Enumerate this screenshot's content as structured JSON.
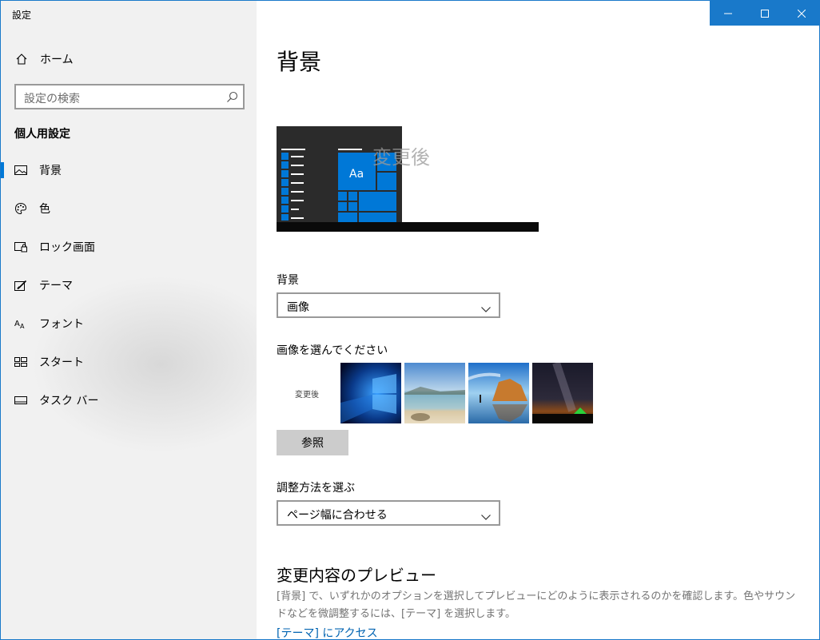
{
  "window": {
    "title": "設定",
    "controls": [
      "minimize-icon",
      "maximize-icon",
      "close-icon"
    ],
    "accent": "#0078d7"
  },
  "sidebar": {
    "home_label": "ホーム",
    "search_placeholder": "設定の検索",
    "section_title": "個人用設定",
    "items": [
      {
        "label": "背景",
        "icon": "picture-icon",
        "active": true
      },
      {
        "label": "色",
        "icon": "palette-icon",
        "active": false
      },
      {
        "label": "ロック画面",
        "icon": "lock-screen-icon",
        "active": false
      },
      {
        "label": "テーマ",
        "icon": "theme-brush-icon",
        "active": false
      },
      {
        "label": "フォント",
        "icon": "font-icon",
        "active": false
      },
      {
        "label": "スタート",
        "icon": "start-icon",
        "active": false
      },
      {
        "label": "タスク バー",
        "icon": "taskbar-icon",
        "active": false
      }
    ]
  },
  "main": {
    "title": "背景",
    "preview": {
      "tile_text": "Aa",
      "overlay_text": "変更後"
    },
    "background_label": "背景",
    "background_value": "画像",
    "choose_picture_label": "画像を選んでください",
    "thumbnails": [
      {
        "type": "text",
        "text": "変更後"
      },
      {
        "type": "image",
        "name": "windows-logo-wallpaper"
      },
      {
        "type": "image",
        "name": "beach-wallpaper"
      },
      {
        "type": "image",
        "name": "rock-arch-wallpaper"
      },
      {
        "type": "image",
        "name": "night-sky-wallpaper"
      }
    ],
    "browse_label": "参照",
    "fit_label": "調整方法を選ぶ",
    "fit_value": "ページ幅に合わせる",
    "preview_section_title": "変更内容のプレビュー",
    "preview_description": "[背景] で、いずれかのオプションを選択してプレビューにどのように表示されるのかを確認します。色やサウンドなどを微調整するには、[テーマ] を選択します。",
    "theme_link": "[テーマ] にアクセス"
  }
}
